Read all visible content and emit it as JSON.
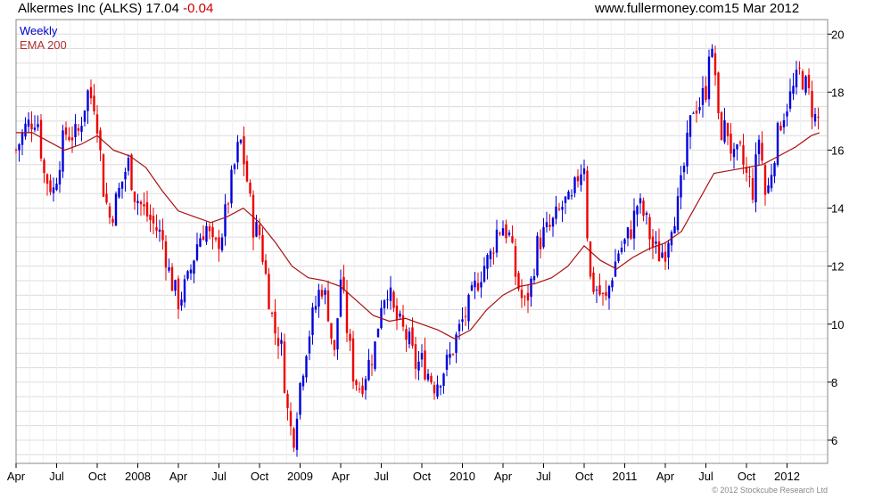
{
  "header": {
    "title_main": "Alkermes Inc (ALKS) 17.04",
    "title_change": "-0.04",
    "site": "www.fullermoney.com",
    "date": "15 Mar 2012"
  },
  "legend": {
    "primary": "Weekly",
    "secondary": "EMA 200"
  },
  "footer": {
    "copyright": "© 2012 Stockcube Research Ltd"
  },
  "colors": {
    "up": "#0000dd",
    "down": "#ee0000",
    "ema": "#aa1111",
    "grid": "#dcdcdc"
  },
  "chart_data": {
    "type": "candlestick",
    "frequency": "weekly",
    "yaxis": {
      "side": "right",
      "ylim": [
        5.2,
        20.5
      ],
      "ticks": [
        6,
        8,
        10,
        12,
        14,
        16,
        18,
        20
      ]
    },
    "xaxis": {
      "range": [
        2007.25,
        2012.25
      ],
      "ticks": [
        {
          "t": 2007.25,
          "label": "Apr"
        },
        {
          "t": 2007.5,
          "label": "Jul"
        },
        {
          "t": 2007.75,
          "label": "Oct"
        },
        {
          "t": 2008.0,
          "label": "2008"
        },
        {
          "t": 2008.25,
          "label": "Apr"
        },
        {
          "t": 2008.5,
          "label": "Jul"
        },
        {
          "t": 2008.75,
          "label": "Oct"
        },
        {
          "t": 2009.0,
          "label": "2009"
        },
        {
          "t": 2009.25,
          "label": "Apr"
        },
        {
          "t": 2009.5,
          "label": "Jul"
        },
        {
          "t": 2009.75,
          "label": "Oct"
        },
        {
          "t": 2010.0,
          "label": "2010"
        },
        {
          "t": 2010.25,
          "label": "Apr"
        },
        {
          "t": 2010.5,
          "label": "Jul"
        },
        {
          "t": 2010.75,
          "label": "Oct"
        },
        {
          "t": 2011.0,
          "label": "2011"
        },
        {
          "t": 2011.25,
          "label": "Apr"
        },
        {
          "t": 2011.5,
          "label": "Jul"
        },
        {
          "t": 2011.75,
          "label": "Oct"
        },
        {
          "t": 2012.0,
          "label": "2012"
        }
      ]
    },
    "close_path": [
      [
        2007.25,
        16.0
      ],
      [
        2007.31,
        16.8
      ],
      [
        2007.38,
        17.2
      ],
      [
        2007.42,
        15.2
      ],
      [
        2007.48,
        14.6
      ],
      [
        2007.55,
        16.6
      ],
      [
        2007.63,
        16.5
      ],
      [
        2007.69,
        18.0
      ],
      [
        2007.74,
        17.6
      ],
      [
        2007.79,
        14.6
      ],
      [
        2007.83,
        13.6
      ],
      [
        2007.88,
        14.5
      ],
      [
        2007.94,
        15.6
      ],
      [
        2007.98,
        14.5
      ],
      [
        2008.04,
        13.9
      ],
      [
        2008.1,
        13.4
      ],
      [
        2008.15,
        13.0
      ],
      [
        2008.2,
        11.6
      ],
      [
        2008.25,
        10.8
      ],
      [
        2008.31,
        11.5
      ],
      [
        2008.37,
        12.9
      ],
      [
        2008.42,
        13.4
      ],
      [
        2008.47,
        12.5
      ],
      [
        2008.52,
        13.2
      ],
      [
        2008.58,
        15.0
      ],
      [
        2008.63,
        16.4
      ],
      [
        2008.67,
        15.1
      ],
      [
        2008.71,
        13.4
      ],
      [
        2008.75,
        13.1
      ],
      [
        2008.79,
        11.6
      ],
      [
        2008.84,
        9.8
      ],
      [
        2008.88,
        9.4
      ],
      [
        2008.93,
        6.6
      ],
      [
        2008.96,
        6.1
      ],
      [
        2008.99,
        7.6
      ],
      [
        2009.04,
        9.3
      ],
      [
        2009.08,
        10.3
      ],
      [
        2009.13,
        11.4
      ],
      [
        2009.17,
        10.6
      ],
      [
        2009.21,
        8.8
      ],
      [
        2009.25,
        11.6
      ],
      [
        2009.29,
        9.8
      ],
      [
        2009.33,
        8.2
      ],
      [
        2009.37,
        7.8
      ],
      [
        2009.42,
        8.6
      ],
      [
        2009.46,
        9.2
      ],
      [
        2009.5,
        10.8
      ],
      [
        2009.54,
        11.3
      ],
      [
        2009.58,
        10.3
      ],
      [
        2009.63,
        9.8
      ],
      [
        2009.67,
        9.4
      ],
      [
        2009.71,
        8.6
      ],
      [
        2009.75,
        8.7
      ],
      [
        2009.79,
        8.3
      ],
      [
        2009.83,
        7.9
      ],
      [
        2009.88,
        8.4
      ],
      [
        2009.92,
        8.8
      ],
      [
        2009.96,
        9.5
      ],
      [
        2010.0,
        10.1
      ],
      [
        2010.04,
        10.6
      ],
      [
        2010.08,
        11.3
      ],
      [
        2010.13,
        12.0
      ],
      [
        2010.17,
        12.3
      ],
      [
        2010.21,
        13.2
      ],
      [
        2010.25,
        13.4
      ],
      [
        2010.29,
        13.0
      ],
      [
        2010.33,
        11.6
      ],
      [
        2010.38,
        10.6
      ],
      [
        2010.42,
        11.3
      ],
      [
        2010.46,
        12.7
      ],
      [
        2010.5,
        13.1
      ],
      [
        2010.54,
        13.3
      ],
      [
        2010.58,
        13.7
      ],
      [
        2010.63,
        14.2
      ],
      [
        2010.67,
        14.1
      ],
      [
        2010.71,
        15.1
      ],
      [
        2010.75,
        15.6
      ],
      [
        2010.77,
        13.1
      ],
      [
        2010.79,
        11.4
      ],
      [
        2010.83,
        11.2
      ],
      [
        2010.88,
        10.7
      ],
      [
        2010.92,
        11.7
      ],
      [
        2010.96,
        12.5
      ],
      [
        2011.0,
        12.8
      ],
      [
        2011.04,
        13.3
      ],
      [
        2011.08,
        14.2
      ],
      [
        2011.13,
        13.6
      ],
      [
        2011.17,
        12.7
      ],
      [
        2011.21,
        12.4
      ],
      [
        2011.25,
        12.6
      ],
      [
        2011.29,
        13.6
      ],
      [
        2011.33,
        14.1
      ],
      [
        2011.37,
        15.6
      ],
      [
        2011.42,
        17.5
      ],
      [
        2011.46,
        17.6
      ],
      [
        2011.5,
        18.1
      ],
      [
        2011.52,
        19.6
      ],
      [
        2011.56,
        18.6
      ],
      [
        2011.58,
        16.6
      ],
      [
        2011.63,
        16.8
      ],
      [
        2011.67,
        15.6
      ],
      [
        2011.71,
        15.9
      ],
      [
        2011.75,
        15.1
      ],
      [
        2011.79,
        14.6
      ],
      [
        2011.83,
        16.6
      ],
      [
        2011.87,
        14.2
      ],
      [
        2011.92,
        15.9
      ],
      [
        2011.96,
        17.0
      ],
      [
        2012.0,
        17.6
      ],
      [
        2012.04,
        18.1
      ],
      [
        2012.08,
        18.7
      ],
      [
        2012.13,
        18.0
      ],
      [
        2012.17,
        17.1
      ],
      [
        2012.2,
        17.04
      ]
    ],
    "ema200": [
      [
        2007.25,
        16.6
      ],
      [
        2007.35,
        16.6
      ],
      [
        2007.45,
        16.3
      ],
      [
        2007.55,
        16.0
      ],
      [
        2007.65,
        16.2
      ],
      [
        2007.75,
        16.5
      ],
      [
        2007.85,
        16.0
      ],
      [
        2007.95,
        15.8
      ],
      [
        2008.05,
        15.4
      ],
      [
        2008.15,
        14.6
      ],
      [
        2008.25,
        13.9
      ],
      [
        2008.35,
        13.7
      ],
      [
        2008.45,
        13.5
      ],
      [
        2008.55,
        13.7
      ],
      [
        2008.65,
        14.0
      ],
      [
        2008.75,
        13.5
      ],
      [
        2008.85,
        12.8
      ],
      [
        2008.95,
        12.0
      ],
      [
        2009.05,
        11.6
      ],
      [
        2009.15,
        11.5
      ],
      [
        2009.25,
        11.3
      ],
      [
        2009.35,
        10.8
      ],
      [
        2009.45,
        10.3
      ],
      [
        2009.55,
        10.1
      ],
      [
        2009.65,
        10.2
      ],
      [
        2009.75,
        10.0
      ],
      [
        2009.85,
        9.8
      ],
      [
        2009.95,
        9.5
      ],
      [
        2010.05,
        9.8
      ],
      [
        2010.15,
        10.5
      ],
      [
        2010.25,
        11.0
      ],
      [
        2010.35,
        11.3
      ],
      [
        2010.45,
        11.4
      ],
      [
        2010.55,
        11.6
      ],
      [
        2010.65,
        12.0
      ],
      [
        2010.75,
        12.7
      ],
      [
        2010.85,
        12.2
      ],
      [
        2010.95,
        11.9
      ],
      [
        2011.05,
        12.3
      ],
      [
        2011.15,
        12.6
      ],
      [
        2011.25,
        12.8
      ],
      [
        2011.35,
        13.2
      ],
      [
        2011.45,
        14.2
      ],
      [
        2011.55,
        15.2
      ],
      [
        2011.65,
        15.3
      ],
      [
        2011.75,
        15.4
      ],
      [
        2011.85,
        15.5
      ],
      [
        2011.95,
        15.8
      ],
      [
        2012.05,
        16.1
      ],
      [
        2012.15,
        16.5
      ],
      [
        2012.2,
        16.6
      ]
    ]
  }
}
